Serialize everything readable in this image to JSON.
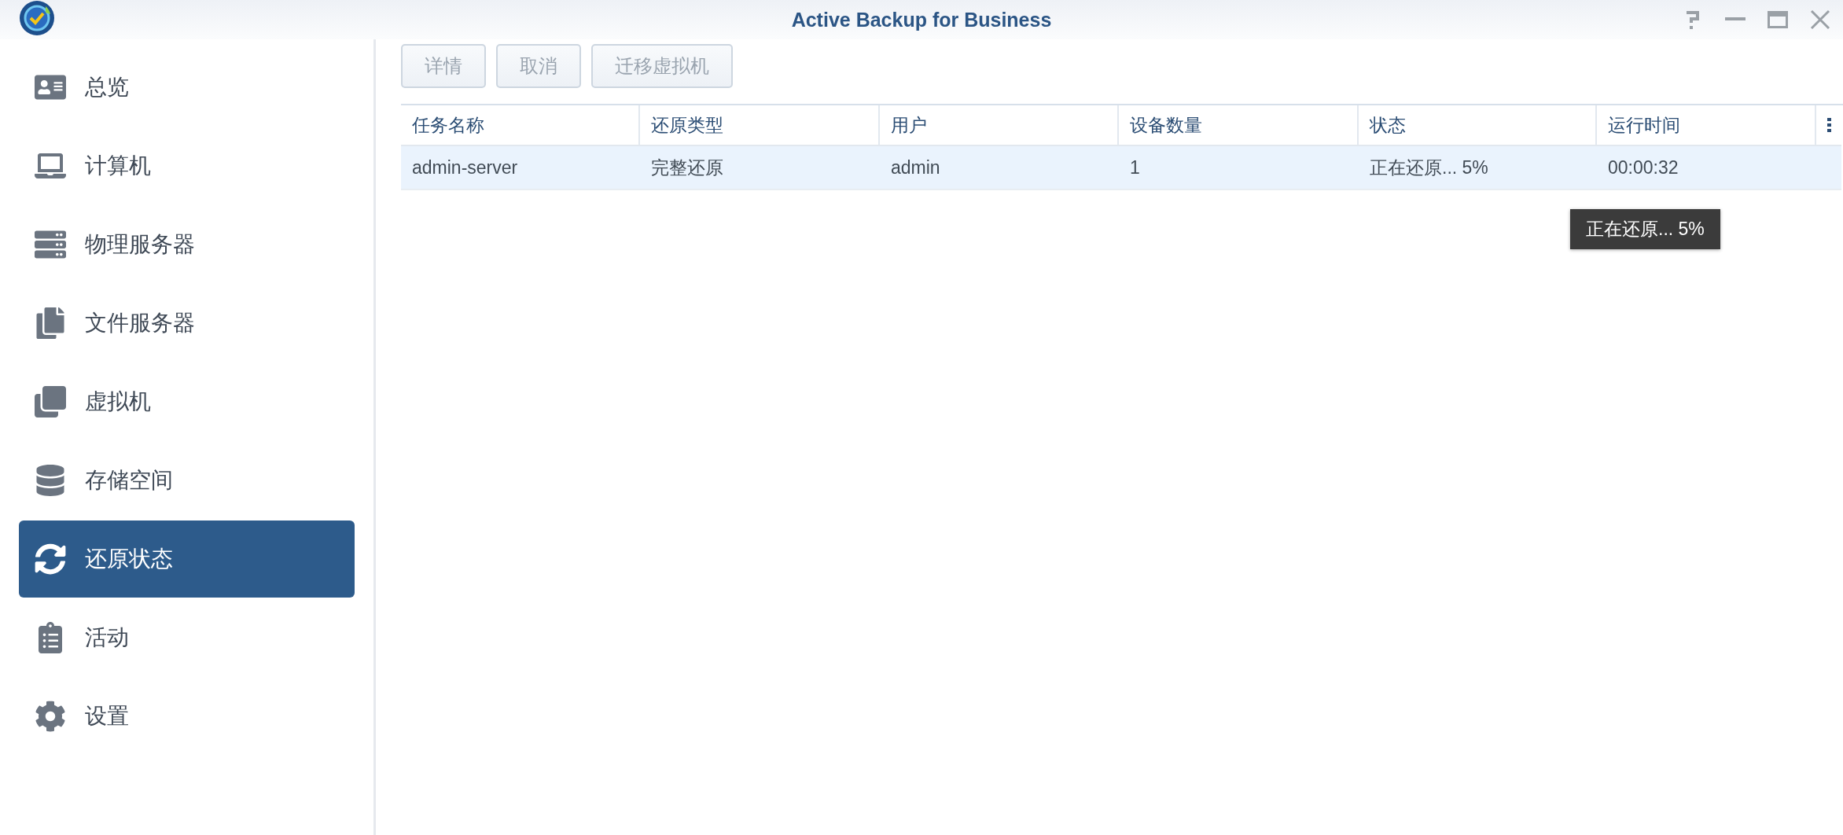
{
  "window": {
    "title": "Active Backup for Business"
  },
  "sidebar": {
    "items": [
      {
        "label": "总览",
        "selected": false
      },
      {
        "label": "计算机",
        "selected": false
      },
      {
        "label": "物理服务器",
        "selected": false
      },
      {
        "label": "文件服务器",
        "selected": false
      },
      {
        "label": "虚拟机",
        "selected": false
      },
      {
        "label": "存储空间",
        "selected": false
      },
      {
        "label": "还原状态",
        "selected": true
      },
      {
        "label": "活动",
        "selected": false
      },
      {
        "label": "设置",
        "selected": false
      }
    ]
  },
  "toolbar": {
    "buttons": [
      {
        "label": "详情",
        "disabled": true
      },
      {
        "label": "取消",
        "disabled": true
      },
      {
        "label": "迁移虚拟机",
        "disabled": true
      }
    ]
  },
  "table": {
    "columns": [
      "任务名称",
      "还原类型",
      "用户",
      "设备数量",
      "状态",
      "运行时间"
    ],
    "rows": [
      {
        "cells": [
          "admin-server",
          "完整还原",
          "admin",
          "1",
          "正在还原... 5%",
          "00:00:32"
        ],
        "selected": true
      }
    ]
  },
  "tooltip": {
    "text": "正在还原... 5%"
  }
}
